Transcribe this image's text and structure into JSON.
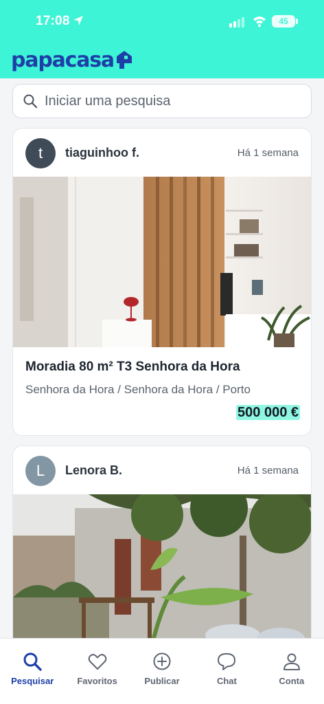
{
  "status_bar": {
    "time": "17:08",
    "battery": "45"
  },
  "brand": {
    "name": "papacasa",
    "color": "#1e3fa8",
    "accent": "#3df5d6"
  },
  "search": {
    "placeholder": "Iniciar uma pesquisa"
  },
  "listings": [
    {
      "user_initial": "t",
      "user_name": "tiaguinhoo f.",
      "posted": "Há 1 semana",
      "title": "Moradia 80 m² T3 Senhora da Hora",
      "location": "Senhora da Hora / Senhora da Hora / Porto",
      "price": "500 000 €",
      "image": "interior-living-room-photo"
    },
    {
      "user_initial": "L",
      "user_name": "Lenora B.",
      "posted": "Há 1 semana",
      "image": "old-stone-house-garden-photo"
    }
  ],
  "nav": [
    {
      "label": "Pesquisar",
      "icon": "search-icon",
      "active": true
    },
    {
      "label": "Favoritos",
      "icon": "heart-icon",
      "active": false
    },
    {
      "label": "Publicar",
      "icon": "plus-circle-icon",
      "active": false
    },
    {
      "label": "Chat",
      "icon": "chat-icon",
      "active": false
    },
    {
      "label": "Conta",
      "icon": "user-icon",
      "active": false
    }
  ]
}
